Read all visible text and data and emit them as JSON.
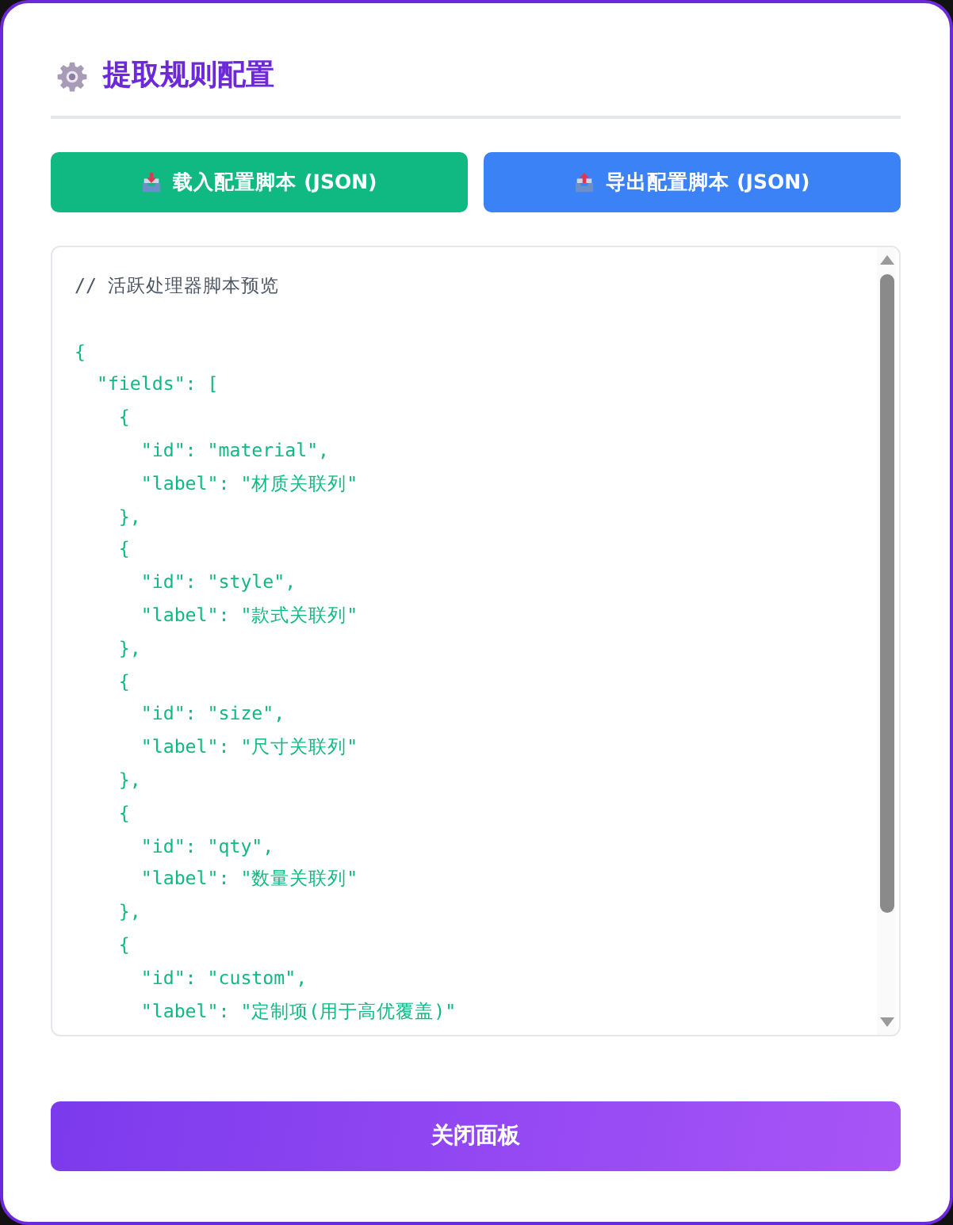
{
  "panel": {
    "title": "提取规则配置",
    "actions": [
      {
        "label": "载入配置脚本 (JSON)",
        "kind": "import"
      },
      {
        "label": "导出配置脚本 (JSON)",
        "kind": "export"
      }
    ],
    "script_preview": {
      "comment": "// 活跃处理器脚本预览",
      "lines": [
        "{",
        "  \"fields\": [",
        "    {",
        "      \"id\": \"material\",",
        "      \"label\": \"材质关联列\"",
        "    },",
        "    {",
        "      \"id\": \"style\",",
        "      \"label\": \"款式关联列\"",
        "    },",
        "    {",
        "      \"id\": \"size\",",
        "      \"label\": \"尺寸关联列\"",
        "    },",
        "    {",
        "      \"id\": \"qty\",",
        "      \"label\": \"数量关联列\"",
        "    },",
        "    {",
        "      \"id\": \"custom\",",
        "      \"label\": \"定制项(用于高优覆盖)\""
      ]
    },
    "close_button": {
      "label": "关闭面板"
    }
  }
}
